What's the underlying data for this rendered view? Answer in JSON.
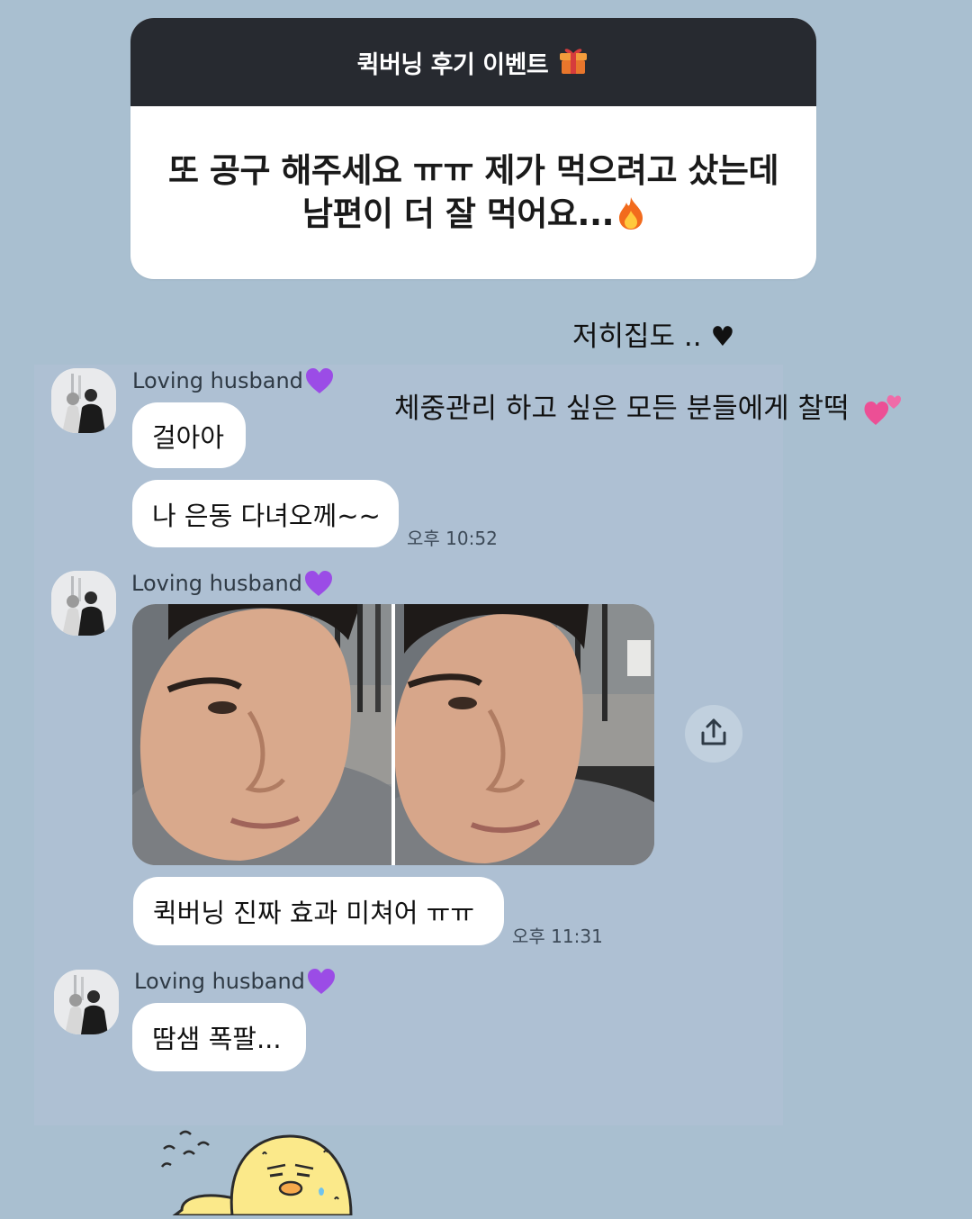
{
  "question": {
    "title": "퀵버닝 후기 이벤트",
    "title_icon": "gift-icon",
    "answer_line1": "또 공구 해주세요 ㅠㅠ 제가 먹으려고 샀는데",
    "answer_line2": "남편이 더 잘 먹어요...",
    "answer_icon": "fire-icon"
  },
  "overlay": {
    "line1": "저히집도 ..",
    "line1_icon": "black-heart-icon",
    "line2": "체중관리 하고 싶은 모든 분들에게 찰떡",
    "line2_icon": "two-pink-hearts-icon"
  },
  "chat": {
    "sender_name": "Loving husband",
    "sender_icon": "purple-heart-icon",
    "group1": {
      "messages": [
        "걸아아",
        "나 은동 다녀오께~~"
      ],
      "time": "오후 10:52"
    },
    "group2": {
      "photo": "selfie-photo-pair",
      "message": "퀵버닝 진짜 효과 미쳐어 ㅠㅠ",
      "time": "오후 11:31"
    },
    "group3": {
      "message": "땀샘 폭팔..."
    }
  },
  "colors": {
    "background": "#a9bfd0",
    "sticker_header": "#272a30",
    "bubble": "#ffffff"
  }
}
